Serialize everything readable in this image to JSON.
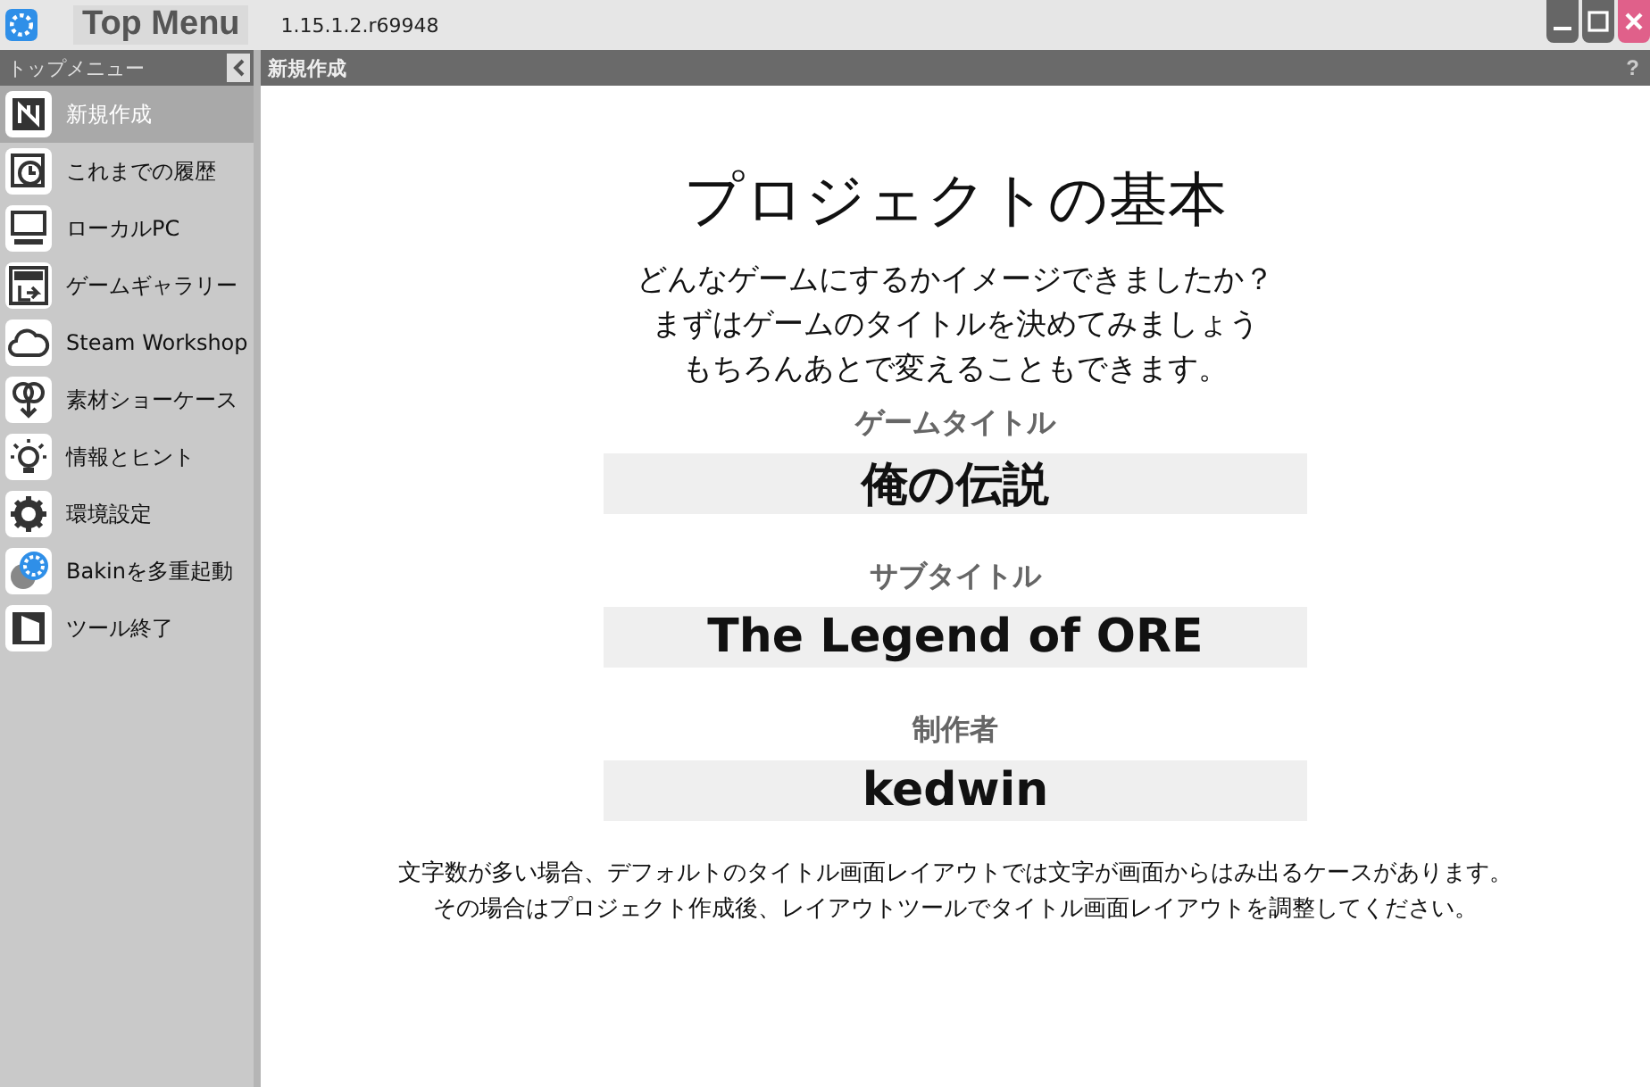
{
  "app": {
    "logo_text": "Top Menu",
    "version": "1.15.1.2.r69948"
  },
  "help": "?",
  "sidebar": {
    "header": "トップメニュー",
    "items": [
      {
        "label": "新規作成",
        "selected": true,
        "kind": "new"
      },
      {
        "label": "これまでの履歴",
        "selected": false,
        "kind": "history"
      },
      {
        "label": "ローカルPC",
        "selected": false,
        "kind": "pc"
      },
      {
        "label": "ゲームギャラリー",
        "selected": false,
        "kind": "gallery"
      },
      {
        "label": "Steam Workshop",
        "selected": false,
        "kind": "cloud"
      },
      {
        "label": "素材ショーケース",
        "selected": false,
        "kind": "showcase"
      },
      {
        "label": "情報とヒント",
        "selected": false,
        "kind": "bulb"
      },
      {
        "label": "環境設定",
        "selected": false,
        "kind": "gear"
      },
      {
        "label": "Bakinを多重起動",
        "selected": false,
        "kind": "multi"
      },
      {
        "label": "ツール終了",
        "selected": false,
        "kind": "exit"
      }
    ]
  },
  "page": {
    "header": "新規作成",
    "title": "プロジェクトの基本",
    "intro": [
      "どんなゲームにするかイメージできましたか？",
      "まずはゲームのタイトルを決めてみましょう",
      "もちろんあとで変えることもできます。"
    ],
    "fields": [
      {
        "label": "ゲームタイトル",
        "value": "俺の伝説"
      },
      {
        "label": "サブタイトル",
        "value": "The Legend of ORE"
      },
      {
        "label": "制作者",
        "value": "kedwin"
      }
    ],
    "notes": [
      "文字数が多い場合、デフォルトのタイトル画面レイアウトでは文字が画面からはみ出るケースがあります。",
      "その場合はプロジェクト作成後、レイアウトツールでタイトル画面レイアウトを調整してください。"
    ]
  }
}
